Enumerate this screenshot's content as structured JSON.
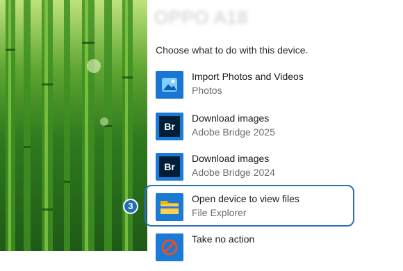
{
  "panel": {
    "device_title": "OPPO A18",
    "prompt": "Choose what to do with this device.",
    "options": [
      {
        "title": "Import Photos and Videos",
        "subtitle": "Photos",
        "icon": "photos-icon"
      },
      {
        "title": "Download images",
        "subtitle": "Adobe Bridge 2025",
        "icon": "adobe-bridge-icon",
        "icon_text": "Br"
      },
      {
        "title": "Download images",
        "subtitle": "Adobe Bridge 2024",
        "icon": "adobe-bridge-icon",
        "icon_text": "Br"
      },
      {
        "title": "Open device to view files",
        "subtitle": "File Explorer",
        "icon": "file-explorer-icon",
        "selected": true
      },
      {
        "title": "Take no action",
        "subtitle": "",
        "icon": "no-action-icon"
      }
    ]
  },
  "step_badge": "3",
  "colors": {
    "accent": "#1b7ad6",
    "highlight_border": "#2b6fb8",
    "bridge_dark": "#001e36"
  }
}
